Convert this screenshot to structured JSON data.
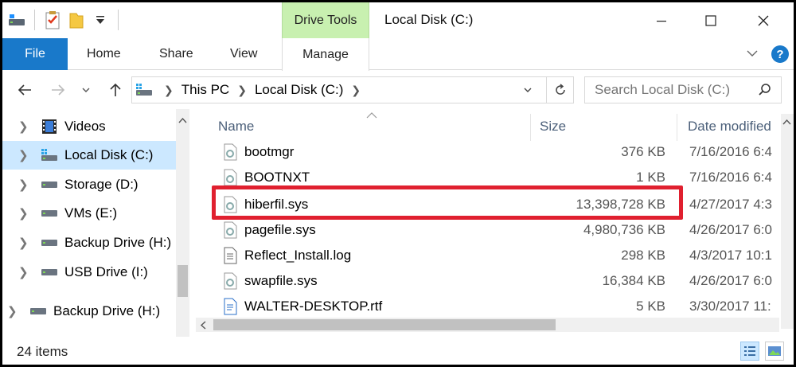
{
  "window": {
    "title": "Local Disk (C:)",
    "context_tab_group": "Drive Tools"
  },
  "ribbon": {
    "tabs": [
      {
        "label": "File"
      },
      {
        "label": "Home"
      },
      {
        "label": "Share"
      },
      {
        "label": "View"
      },
      {
        "label": "Manage"
      }
    ]
  },
  "address": {
    "crumbs": [
      "This PC",
      "Local Disk (C:)"
    ],
    "search_placeholder": "Search Local Disk (C:)"
  },
  "nav_pane": {
    "items": [
      {
        "label": "Videos",
        "icon": "videos-folder-icon"
      },
      {
        "label": "Local Disk (C:)",
        "icon": "windows-drive-icon",
        "selected": true
      },
      {
        "label": "Storage (D:)",
        "icon": "drive-icon"
      },
      {
        "label": "VMs (E:)",
        "icon": "drive-icon"
      },
      {
        "label": "Backup Drive (H:)",
        "icon": "drive-icon"
      },
      {
        "label": "USB Drive (I:)",
        "icon": "drive-icon"
      },
      {
        "label": "Backup Drive (H:)",
        "icon": "drive-icon"
      }
    ]
  },
  "columns": {
    "name": "Name",
    "size": "Size",
    "date": "Date modified"
  },
  "files": [
    {
      "name": "bootmgr",
      "size": "376 KB",
      "date": "7/16/2016 6:4",
      "icon": "system-file-icon"
    },
    {
      "name": "BOOTNXT",
      "size": "1 KB",
      "date": "7/16/2016 6:4",
      "icon": "system-file-icon"
    },
    {
      "name": "hiberfil.sys",
      "size": "13,398,728 KB",
      "date": "4/27/2017 4:3",
      "icon": "system-file-icon",
      "highlighted": true
    },
    {
      "name": "pagefile.sys",
      "size": "4,980,736 KB",
      "date": "4/26/2017 6:0",
      "icon": "system-file-icon"
    },
    {
      "name": "Reflect_Install.log",
      "size": "298 KB",
      "date": "4/3/2017 10:1",
      "icon": "text-file-icon"
    },
    {
      "name": "swapfile.sys",
      "size": "16,384 KB",
      "date": "4/26/2017 6:0",
      "icon": "system-file-icon"
    },
    {
      "name": "WALTER-DESKTOP.rtf",
      "size": "5 KB",
      "date": "3/30/2017 11:",
      "icon": "rtf-file-icon"
    }
  ],
  "status": {
    "item_count": "24 items"
  },
  "colors": {
    "accent": "#1979ca",
    "drive_tools": "#c8f0b0",
    "selection": "#cce8ff",
    "highlight_border": "#e0202f"
  }
}
